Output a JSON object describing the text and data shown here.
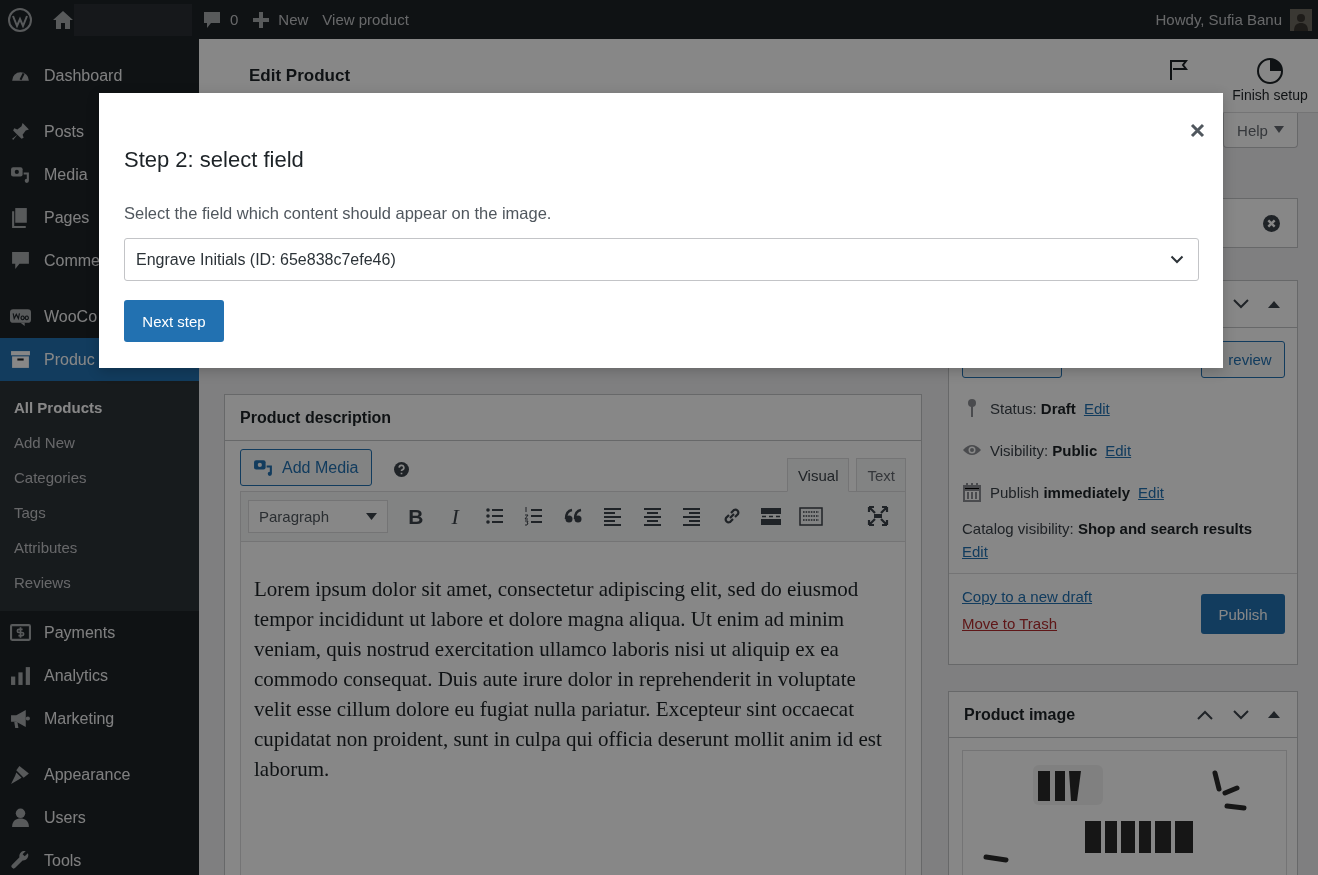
{
  "top_bar": {
    "comments_count": "0",
    "new_label": "New",
    "view_label": "View product",
    "greeting": "Howdy, Sufia Banu"
  },
  "sidebar": {
    "groups": [
      [
        {
          "label": "Dashboard",
          "selected": false
        }
      ],
      [
        {
          "label": "Posts",
          "selected": false
        },
        {
          "label": "Media",
          "selected": false
        },
        {
          "label": "Pages",
          "selected": false
        },
        {
          "label": "Comme",
          "selected": false
        }
      ],
      [
        {
          "label": "WooCo",
          "selected": false
        },
        {
          "label": "Produc",
          "selected": true,
          "children": [
            {
              "label": "All Products",
              "selected": true
            },
            {
              "label": "Add New",
              "selected": false
            },
            {
              "label": "Categories",
              "selected": false
            },
            {
              "label": "Tags",
              "selected": false
            },
            {
              "label": "Attributes",
              "selected": false
            },
            {
              "label": "Reviews",
              "selected": false
            }
          ]
        },
        {
          "label": "Payments",
          "selected": false
        },
        {
          "label": "Analytics",
          "selected": false
        },
        {
          "label": "Marketing",
          "selected": false
        }
      ],
      [
        {
          "label": "Appearance",
          "selected": false
        },
        {
          "label": "Users",
          "selected": false
        },
        {
          "label": "Tools",
          "selected": false
        }
      ]
    ]
  },
  "header": {
    "title": "Edit Product",
    "finish_setup_label": "Finish setup",
    "help_label": "Help"
  },
  "description": {
    "title": "Product description",
    "add_media": "Add Media",
    "tabs": [
      {
        "label": "Visual",
        "selected": true
      },
      {
        "label": "Text",
        "selected": false
      }
    ],
    "format": "Paragraph",
    "toolbar": [
      {
        "kind": "bold",
        "text": "B"
      },
      {
        "kind": "italic",
        "text": "I"
      },
      {
        "kind": "bullets"
      },
      {
        "kind": "numbers"
      },
      {
        "kind": "quote"
      },
      {
        "kind": "align-left"
      },
      {
        "kind": "align-center"
      },
      {
        "kind": "align-right"
      },
      {
        "kind": "link"
      },
      {
        "kind": "more"
      },
      {
        "kind": "keyboard"
      },
      {
        "kind": "fullscreen"
      }
    ],
    "content": "Lorem ipsum dolor sit amet, consectetur adipiscing elit, sed do eiusmod tempor incididunt ut labore et dolore magna aliqua. Ut enim ad minim veniam, quis nostrud exercitation ullamco laboris nisi ut aliquip ex ea commodo consequat. Duis aute irure dolor in reprehenderit in voluptate velit esse cillum dolore eu fugiat nulla pariatur. Excepteur sint occaecat cupidatat non proident, sunt in culpa qui officia deserunt mollit anim id est laborum."
  },
  "publish_box": {
    "preview_label": "review",
    "rows": [
      {
        "kind": "status",
        "text": "Status: **Draft**",
        "link": "Edit"
      },
      {
        "kind": "visibility",
        "text": "Visibility: **Public**",
        "link": "Edit"
      },
      {
        "kind": "schedule",
        "text": "Publish **immediately**",
        "link": "Edit"
      },
      {
        "kind": "catalog",
        "text": "Catalog visibility: **Shop and search results**",
        "link": "Edit"
      }
    ],
    "copy_link": "Copy to a new draft",
    "trash_link": "Move to Trash",
    "publish_button": "Publish"
  },
  "product_image": {
    "title": "Product image"
  },
  "modal": {
    "title": "Step 2: select field",
    "text": "Select the field which content should appear on the image.",
    "select_value": "Engrave Initials (ID: 65e838c7efe46)",
    "button": "Next step"
  }
}
